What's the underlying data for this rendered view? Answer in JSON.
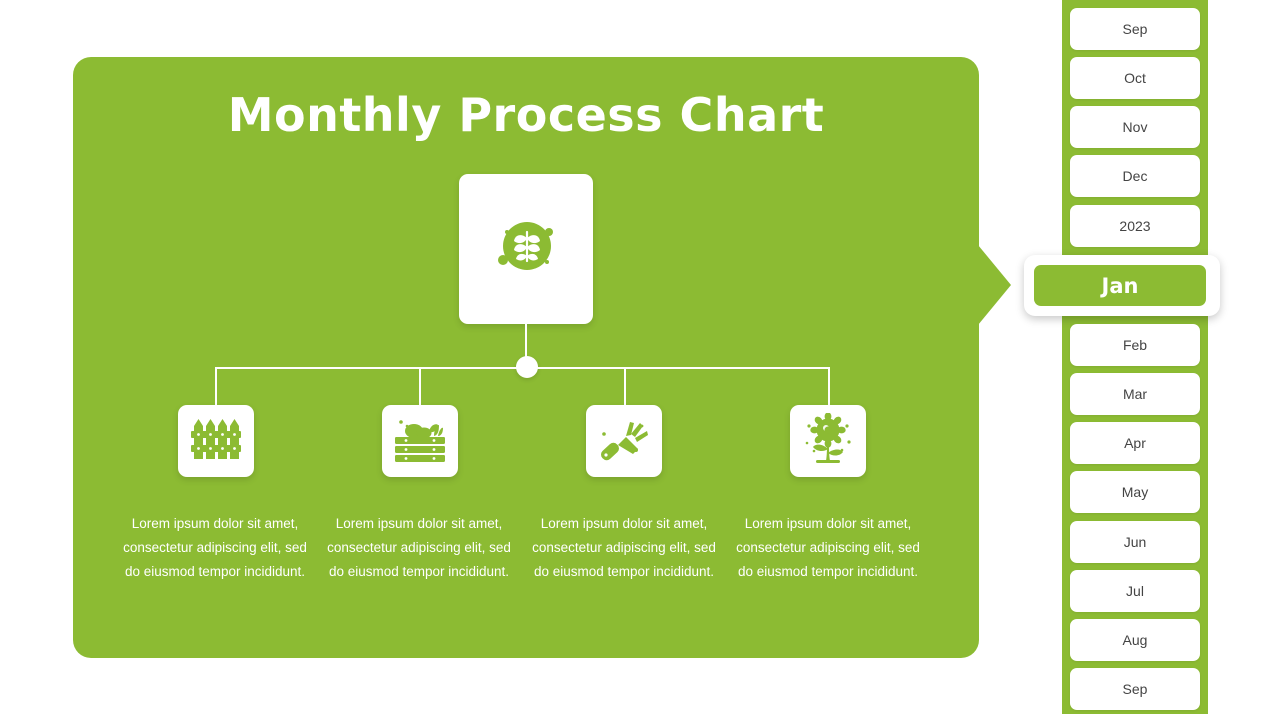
{
  "panel": {
    "title": "Monthly Process Chart",
    "accent_green": "#8cbb33",
    "card_white": "#ffffff"
  },
  "hero": {
    "icon_name": "plant-sprout-icon"
  },
  "nodes": [
    {
      "icon_name": "fence-icon",
      "description": "Lorem ipsum dolor sit amet, consectetur adipiscing elit, sed do eiusmod tempor incididunt."
    },
    {
      "icon_name": "vegetable-crate-icon",
      "description": "Lorem ipsum dolor sit amet, consectetur adipiscing elit, sed do eiusmod tempor incididunt."
    },
    {
      "icon_name": "garden-hand-rake-icon",
      "description": "Lorem ipsum dolor sit amet, consectetur adipiscing elit, sed do eiusmod tempor incididunt."
    },
    {
      "icon_name": "sunflower-icon",
      "description": "Lorem ipsum dolor sit amet, consectetur adipiscing elit, sed do eiusmod tempor incididunt."
    }
  ],
  "sidebar": {
    "selected_label": "Jan",
    "items_above": [
      {
        "label": "Sep"
      },
      {
        "label": "Oct"
      },
      {
        "label": "Nov"
      },
      {
        "label": "Dec"
      },
      {
        "label": "2023"
      }
    ],
    "items_below": [
      {
        "label": "Feb"
      },
      {
        "label": "Mar"
      },
      {
        "label": "Apr"
      },
      {
        "label": "May"
      },
      {
        "label": "Jun"
      },
      {
        "label": "Jul"
      },
      {
        "label": "Aug"
      },
      {
        "label": "Sep"
      }
    ]
  }
}
